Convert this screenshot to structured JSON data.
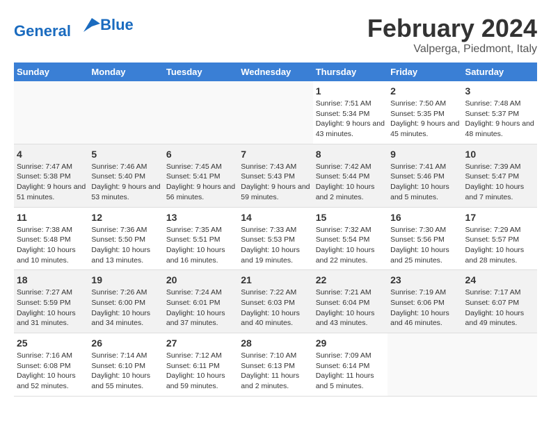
{
  "logo": {
    "line1": "General",
    "line2": "Blue"
  },
  "title": "February 2024",
  "subtitle": "Valperga, Piedmont, Italy",
  "weekdays": [
    "Sunday",
    "Monday",
    "Tuesday",
    "Wednesday",
    "Thursday",
    "Friday",
    "Saturday"
  ],
  "weeks": [
    [
      {
        "day": "",
        "info": ""
      },
      {
        "day": "",
        "info": ""
      },
      {
        "day": "",
        "info": ""
      },
      {
        "day": "",
        "info": ""
      },
      {
        "day": "1",
        "info": "Sunrise: 7:51 AM\nSunset: 5:34 PM\nDaylight: 9 hours\nand 43 minutes."
      },
      {
        "day": "2",
        "info": "Sunrise: 7:50 AM\nSunset: 5:35 PM\nDaylight: 9 hours\nand 45 minutes."
      },
      {
        "day": "3",
        "info": "Sunrise: 7:48 AM\nSunset: 5:37 PM\nDaylight: 9 hours\nand 48 minutes."
      }
    ],
    [
      {
        "day": "4",
        "info": "Sunrise: 7:47 AM\nSunset: 5:38 PM\nDaylight: 9 hours\nand 51 minutes."
      },
      {
        "day": "5",
        "info": "Sunrise: 7:46 AM\nSunset: 5:40 PM\nDaylight: 9 hours\nand 53 minutes."
      },
      {
        "day": "6",
        "info": "Sunrise: 7:45 AM\nSunset: 5:41 PM\nDaylight: 9 hours\nand 56 minutes."
      },
      {
        "day": "7",
        "info": "Sunrise: 7:43 AM\nSunset: 5:43 PM\nDaylight: 9 hours\nand 59 minutes."
      },
      {
        "day": "8",
        "info": "Sunrise: 7:42 AM\nSunset: 5:44 PM\nDaylight: 10 hours\nand 2 minutes."
      },
      {
        "day": "9",
        "info": "Sunrise: 7:41 AM\nSunset: 5:46 PM\nDaylight: 10 hours\nand 5 minutes."
      },
      {
        "day": "10",
        "info": "Sunrise: 7:39 AM\nSunset: 5:47 PM\nDaylight: 10 hours\nand 7 minutes."
      }
    ],
    [
      {
        "day": "11",
        "info": "Sunrise: 7:38 AM\nSunset: 5:48 PM\nDaylight: 10 hours\nand 10 minutes."
      },
      {
        "day": "12",
        "info": "Sunrise: 7:36 AM\nSunset: 5:50 PM\nDaylight: 10 hours\nand 13 minutes."
      },
      {
        "day": "13",
        "info": "Sunrise: 7:35 AM\nSunset: 5:51 PM\nDaylight: 10 hours\nand 16 minutes."
      },
      {
        "day": "14",
        "info": "Sunrise: 7:33 AM\nSunset: 5:53 PM\nDaylight: 10 hours\nand 19 minutes."
      },
      {
        "day": "15",
        "info": "Sunrise: 7:32 AM\nSunset: 5:54 PM\nDaylight: 10 hours\nand 22 minutes."
      },
      {
        "day": "16",
        "info": "Sunrise: 7:30 AM\nSunset: 5:56 PM\nDaylight: 10 hours\nand 25 minutes."
      },
      {
        "day": "17",
        "info": "Sunrise: 7:29 AM\nSunset: 5:57 PM\nDaylight: 10 hours\nand 28 minutes."
      }
    ],
    [
      {
        "day": "18",
        "info": "Sunrise: 7:27 AM\nSunset: 5:59 PM\nDaylight: 10 hours\nand 31 minutes."
      },
      {
        "day": "19",
        "info": "Sunrise: 7:26 AM\nSunset: 6:00 PM\nDaylight: 10 hours\nand 34 minutes."
      },
      {
        "day": "20",
        "info": "Sunrise: 7:24 AM\nSunset: 6:01 PM\nDaylight: 10 hours\nand 37 minutes."
      },
      {
        "day": "21",
        "info": "Sunrise: 7:22 AM\nSunset: 6:03 PM\nDaylight: 10 hours\nand 40 minutes."
      },
      {
        "day": "22",
        "info": "Sunrise: 7:21 AM\nSunset: 6:04 PM\nDaylight: 10 hours\nand 43 minutes."
      },
      {
        "day": "23",
        "info": "Sunrise: 7:19 AM\nSunset: 6:06 PM\nDaylight: 10 hours\nand 46 minutes."
      },
      {
        "day": "24",
        "info": "Sunrise: 7:17 AM\nSunset: 6:07 PM\nDaylight: 10 hours\nand 49 minutes."
      }
    ],
    [
      {
        "day": "25",
        "info": "Sunrise: 7:16 AM\nSunset: 6:08 PM\nDaylight: 10 hours\nand 52 minutes."
      },
      {
        "day": "26",
        "info": "Sunrise: 7:14 AM\nSunset: 6:10 PM\nDaylight: 10 hours\nand 55 minutes."
      },
      {
        "day": "27",
        "info": "Sunrise: 7:12 AM\nSunset: 6:11 PM\nDaylight: 10 hours\nand 59 minutes."
      },
      {
        "day": "28",
        "info": "Sunrise: 7:10 AM\nSunset: 6:13 PM\nDaylight: 11 hours\nand 2 minutes."
      },
      {
        "day": "29",
        "info": "Sunrise: 7:09 AM\nSunset: 6:14 PM\nDaylight: 11 hours\nand 5 minutes."
      },
      {
        "day": "",
        "info": ""
      },
      {
        "day": "",
        "info": ""
      }
    ]
  ]
}
